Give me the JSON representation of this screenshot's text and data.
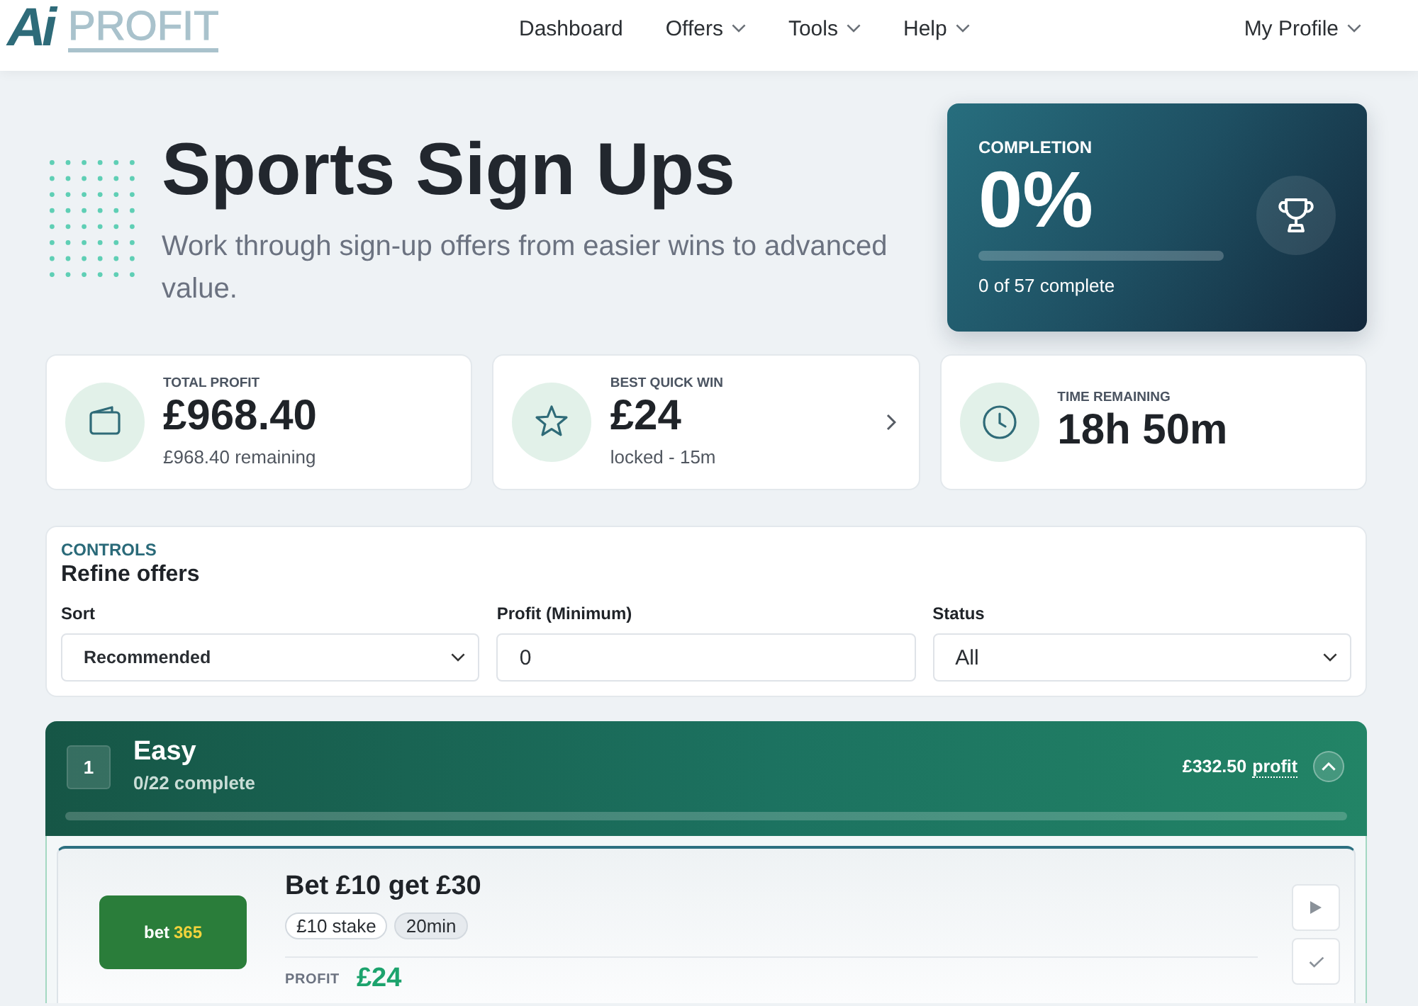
{
  "header": {
    "logo": {
      "mark": "Ai",
      "name": "PROFIT"
    },
    "nav": [
      {
        "label": "Dashboard",
        "has_menu": false
      },
      {
        "label": "Offers",
        "has_menu": true
      },
      {
        "label": "Tools",
        "has_menu": true
      },
      {
        "label": "Help",
        "has_menu": true
      }
    ],
    "profile": {
      "label": "My Profile",
      "has_menu": true
    }
  },
  "hero": {
    "title": "Sports Sign Ups",
    "subtitle": "Work through sign-up offers from easier wins to advanced value."
  },
  "completion": {
    "label": "COMPLETION",
    "percent": "0%",
    "level": 0,
    "summary": "0 of 57 complete"
  },
  "stats": [
    {
      "kind": "wallet",
      "label": "TOTAL PROFIT",
      "value": "£968.40",
      "note": "£968.40 remaining",
      "has_link": false
    },
    {
      "kind": "star",
      "label": "BEST QUICK WIN",
      "value": "£24",
      "note": "locked - 15m",
      "has_link": true
    },
    {
      "kind": "clock",
      "label": "TIME REMAINING",
      "value": "18h 50m",
      "has_link": false
    }
  ],
  "controls": {
    "eyebrow": "CONTROLS",
    "title": "Refine offers",
    "fields": [
      {
        "kind": "select",
        "label": "Sort",
        "value": "Recommended"
      },
      {
        "kind": "number",
        "label": "Profit (Minimum)",
        "value": "0"
      },
      {
        "kind": "select",
        "label": "Status",
        "value": "All"
      }
    ]
  },
  "groups": [
    {
      "number": "1",
      "title": "Easy",
      "progress": "0/22 complete",
      "profit_amount": "£332.50",
      "profit_label": "profit",
      "expanded": true,
      "level": 0,
      "offers": [
        {
          "brand": {
            "name": "bet",
            "accent": "365"
          },
          "title": "Bet £10 get £30",
          "tags": [
            {
              "text": "£10 stake",
              "kind": "outline"
            },
            {
              "text": "20min",
              "kind": "filled"
            }
          ],
          "profit_label": "PROFIT",
          "profit": "£24",
          "actions": [
            {
              "kind": "start"
            },
            {
              "kind": "complete"
            }
          ]
        }
      ]
    }
  ]
}
